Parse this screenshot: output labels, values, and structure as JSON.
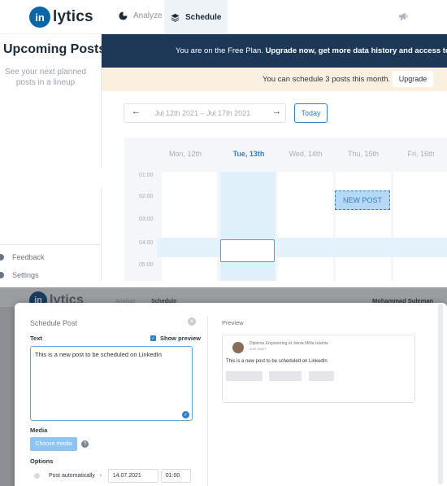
{
  "app": {
    "logo_badge": "in",
    "logo_text": "lytics",
    "nav": {
      "analyze": "Analyze",
      "schedule": "Schedule"
    }
  },
  "sidebar": {
    "title": "Upcoming Posts",
    "subtitle": "See your next planned posts in a lineup",
    "items": [
      {
        "label": "Feedback"
      },
      {
        "label": "Settings"
      }
    ]
  },
  "banner": {
    "prefix": "You are on the Free Plan. ",
    "bold": "Upgrade now, get more data history and access to more fe"
  },
  "limit": {
    "text": "You can schedule 3 posts this month.",
    "button": "Upgrade"
  },
  "calendar": {
    "date_range": "Jul 12th 2021 – Jul 17th 2021",
    "today_label": "Today",
    "days": [
      "Mon, 12th",
      "Tue, 13th",
      "Wed, 14th",
      "Thu, 15th",
      "Fri, 16th"
    ],
    "active_day": "Tue, 13th",
    "hours": [
      "01:00",
      "02:00",
      "03:00",
      "04:00",
      "05:00"
    ],
    "event_label": "NEW POST"
  },
  "background": {
    "logo_text": "lytics",
    "nav_analyze": "Analyze",
    "nav_schedule": "Schedule",
    "user_name": "Mohammad Suleman"
  },
  "modal": {
    "title": "Schedule Post",
    "text_label": "Text",
    "show_preview": "Show preview",
    "post_text": "This is a new post to be scheduled on LinkedIn",
    "media_label": "Media",
    "choose_media": "Choose media",
    "options_label": "Options",
    "post_mode": "Post automatically",
    "date": "14.07.2021",
    "time": "01:00"
  },
  "preview": {
    "title": "Preview",
    "author_headline": "Diploma Engineering at Jamia Millia Islamia",
    "timestamp": "Just now •",
    "body": "This is a new post to be scheduled on LinkedIn"
  },
  "colors": {
    "brand": "#0a66a8",
    "accent": "#2f80c9",
    "banner": "#1d3856",
    "notice": "#fbf0df"
  }
}
